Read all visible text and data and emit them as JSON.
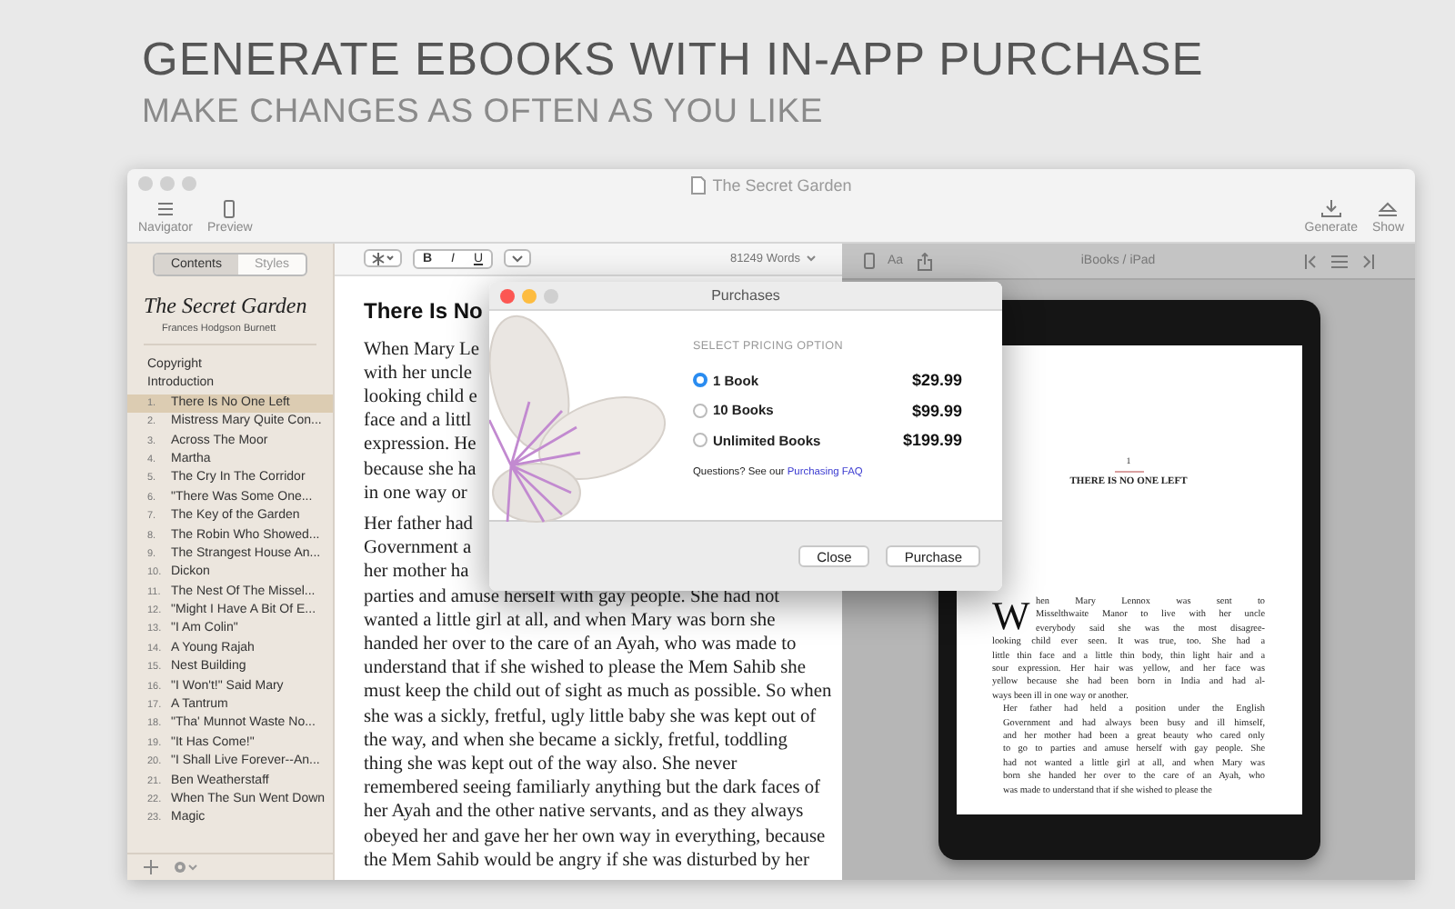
{
  "headline": "GENERATE EBOOKS WITH IN-APP PURCHASE",
  "subheadline": "MAKE CHANGES AS OFTEN AS YOU LIKE",
  "window": {
    "title": "The Secret Garden"
  },
  "toolbar": {
    "left": [
      {
        "label": "Navigator",
        "kind": "list"
      },
      {
        "label": "Preview",
        "kind": "device"
      }
    ],
    "right": [
      {
        "label": "Generate",
        "kind": "download"
      },
      {
        "label": "Show",
        "kind": "eject"
      }
    ]
  },
  "sidebar": {
    "tabs": [
      {
        "label": "Contents",
        "selected": true
      },
      {
        "label": "Styles",
        "selected": false
      }
    ],
    "book_title": "The Secret Garden",
    "author": "Frances Hodgson Burnett",
    "items": [
      {
        "title": "Copyright",
        "selected": false
      },
      {
        "title": "Introduction",
        "selected": false
      },
      {
        "number": "1.",
        "title": "There Is No One Left",
        "selected": true
      },
      {
        "number": "2.",
        "title": "Mistress Mary Quite Con...",
        "selected": false
      },
      {
        "number": "3.",
        "title": "Across The Moor",
        "selected": false
      },
      {
        "number": "4.",
        "title": "Martha",
        "selected": false
      },
      {
        "number": "5.",
        "title": "The Cry In The Corridor",
        "selected": false
      },
      {
        "number": "6.",
        "title": "\"There Was Some One...",
        "selected": false
      },
      {
        "number": "7.",
        "title": "The Key of the Garden",
        "selected": false
      },
      {
        "number": "8.",
        "title": "The Robin Who Showed...",
        "selected": false
      },
      {
        "number": "9.",
        "title": "The Strangest House An...",
        "selected": false
      },
      {
        "number": "10.",
        "title": "Dickon",
        "selected": false
      },
      {
        "number": "11.",
        "title": "The Nest Of The Missel...",
        "selected": false
      },
      {
        "number": "12.",
        "title": "\"Might I Have A Bit Of E...",
        "selected": false
      },
      {
        "number": "13.",
        "title": "\"I Am Colin\"",
        "selected": false
      },
      {
        "number": "14.",
        "title": "A Young Rajah",
        "selected": false
      },
      {
        "number": "15.",
        "title": "Nest Building",
        "selected": false
      },
      {
        "number": "16.",
        "title": "\"I Won't!\" Said Mary",
        "selected": false
      },
      {
        "number": "17.",
        "title": "A Tantrum",
        "selected": false
      },
      {
        "number": "18.",
        "title": "\"Tha' Munnot Waste No...",
        "selected": false
      },
      {
        "number": "19.",
        "title": "\"It Has Come!\"",
        "selected": false
      },
      {
        "number": "20.",
        "title": "\"I Shall Live Forever--An...",
        "selected": false
      },
      {
        "number": "21.",
        "title": "Ben Weatherstaff",
        "selected": false
      },
      {
        "number": "22.",
        "title": "When The Sun Went Down",
        "selected": false
      },
      {
        "number": "23.",
        "title": "Magic",
        "selected": false
      }
    ]
  },
  "editor": {
    "format_buttons": [
      "B",
      "I",
      "U"
    ],
    "word_count": "81249 Words",
    "heading": "There Is No",
    "paragraphs": [
      [
        "When Mary Le",
        "with her uncle",
        "looking child e",
        "face and a littl",
        "expression. He",
        "because she ha",
        "in one way or"
      ],
      [
        "Her father had",
        "Government a",
        "her mother ha",
        "parties and amuse herself with gay people. She had not",
        "wanted a little girl at all, and when Mary was born she",
        "handed her over to the care of an Ayah, who was made to",
        "understand that if she wished to please the Mem Sahib she",
        "must keep the child out of sight as much as possible. So when",
        "she was a sickly, fretful, ugly little baby she was kept out of",
        "the way, and when she became a sickly, fretful, toddling",
        "thing she was kept out of the way also. She never",
        "remembered seeing familiarly anything but the dark faces of",
        "her Ayah and the other native servants, and as they always",
        "obeyed her and gave her her own way in everything, because",
        "the Mem Sahib would be angry if she was disturbed by her"
      ]
    ]
  },
  "preview": {
    "font_button": "Aa",
    "device": "iBooks / iPad",
    "page": {
      "chapter_number": "1",
      "chapter_title": "THERE IS NO ONE LEFT",
      "drop_cap": "W",
      "paragraphs": [
        [
          "hen Mary Lennox was sent to",
          "Misselthwaite Manor to live with her uncle",
          "everybody said she was the most disagree-",
          "looking child ever seen. It was true, too. She had a",
          "little thin face and a little thin body, thin light hair and a",
          "sour expression. Her hair was yellow, and her face was",
          "yellow because she had been born in India and had al-",
          "ways been ill in one way or another."
        ],
        [
          "Her father had held a position under the English",
          "Government and had always been busy and ill himself,",
          "and her mother had been a great beauty who cared only",
          "to go to parties and amuse herself with gay people. She",
          "had not wanted a little girl at all, and when Mary was",
          "born she handed her over to the care of an Ayah, who",
          "was made to understand that if she wished to please the"
        ]
      ]
    }
  },
  "dialog": {
    "title": "Purchases",
    "heading": "SELECT PRICING OPTION",
    "options": [
      {
        "label": "1 Book",
        "price": "$29.99",
        "selected": true
      },
      {
        "label": "10 Books",
        "price": "$99.99",
        "selected": false
      },
      {
        "label": "Unlimited Books",
        "price": "$199.99",
        "selected": false
      }
    ],
    "help_text": "Questions? See our",
    "help_link": "Purchasing FAQ",
    "buttons": [
      "Close",
      "Purchase"
    ]
  }
}
